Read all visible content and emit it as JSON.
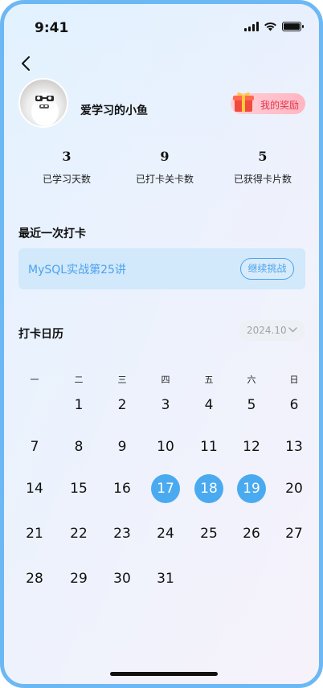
{
  "status": {
    "time": "9:41"
  },
  "profile": {
    "nickname": "爱学习的小鱼",
    "reward_label": "我的奖励"
  },
  "stats": [
    {
      "value": "3",
      "label": "已学习天数"
    },
    {
      "value": "9",
      "label": "已打卡关卡数"
    },
    {
      "value": "5",
      "label": "已获得卡片数"
    }
  ],
  "last_checkin": {
    "title": "最近一次打卡",
    "course": "MySQL实战第25讲",
    "button": "继续挑战"
  },
  "calendar": {
    "title": "打卡日历",
    "month": "2024.10",
    "weekdays": [
      "一",
      "二",
      "三",
      "四",
      "五",
      "六",
      "日"
    ],
    "days": [
      "1",
      "2",
      "3",
      "4",
      "5",
      "6",
      "7",
      "8",
      "9",
      "10",
      "11",
      "12",
      "13",
      "14",
      "15",
      "16",
      "17",
      "18",
      "19",
      "20",
      "21",
      "22",
      "23",
      "24",
      "25",
      "26",
      "27",
      "28",
      "29",
      "30",
      "31"
    ],
    "first_weekday_index": 1,
    "checked_days": [
      17,
      18,
      19
    ],
    "accent": "#4aaaf0"
  }
}
